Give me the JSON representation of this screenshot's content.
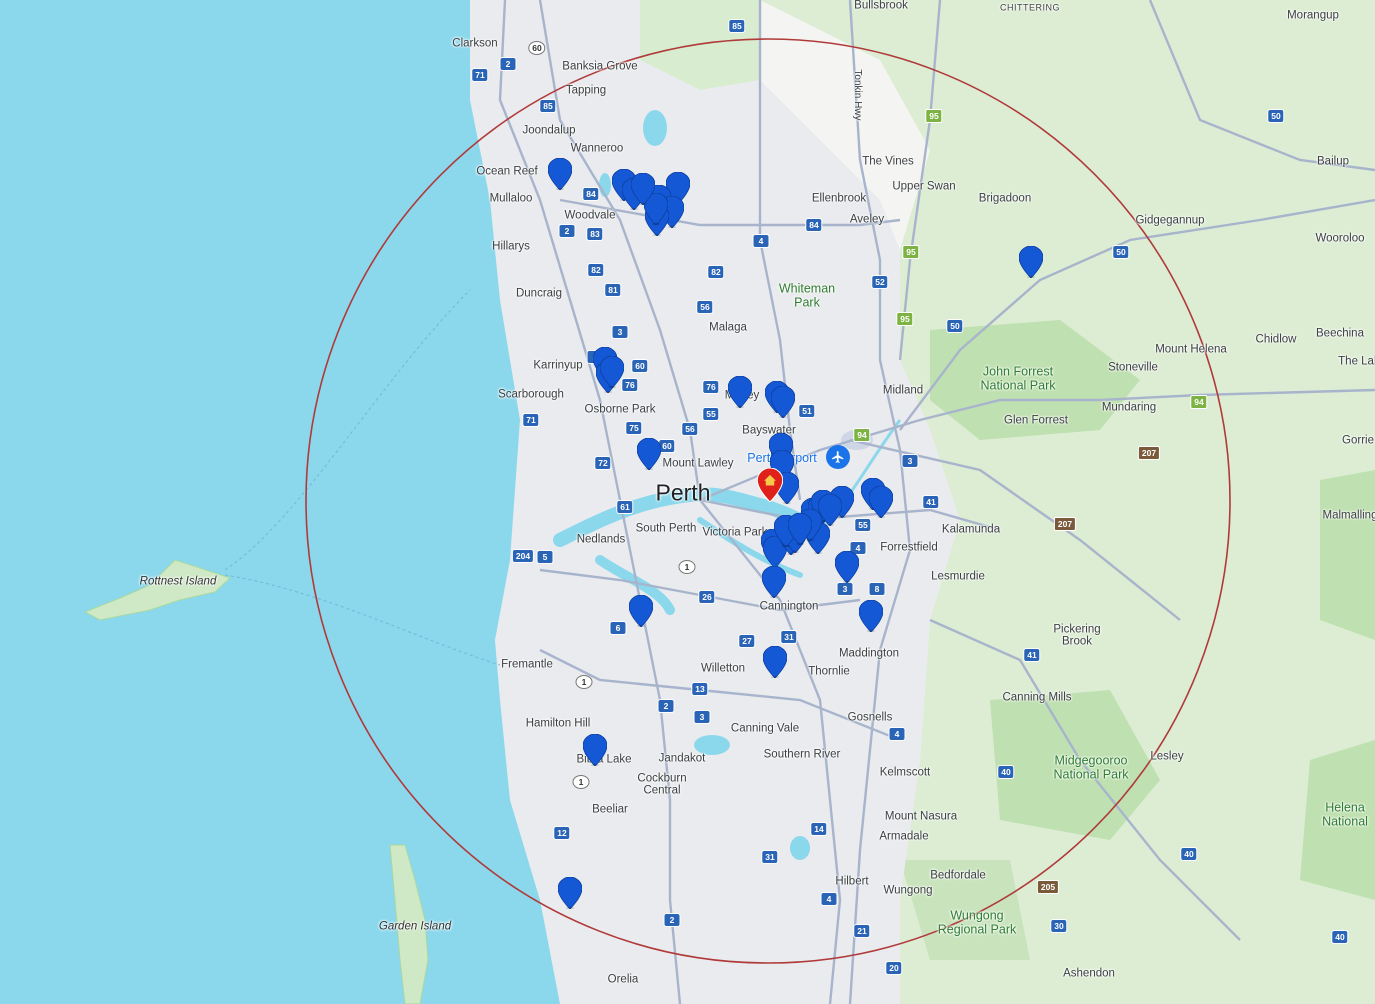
{
  "map": {
    "colors": {
      "water": "#8bd8ec",
      "land": "#f4f4f2",
      "green": "#cfe8c6",
      "urban": "#e8eaed",
      "circle": "#b03a3a",
      "pin_blue": "#1558d6",
      "pin_red": "#e0201a",
      "pin_home": "#f7c948"
    },
    "city_label": "Perth",
    "airport_label": "Perth Airport",
    "islands": [
      {
        "id": "rottnest",
        "name": "Rottnest Island"
      },
      {
        "id": "garden",
        "name": "Garden Island"
      }
    ],
    "places": [
      {
        "name": "Bullsbrook"
      },
      {
        "name": "CHITTERING"
      },
      {
        "name": "Morangup"
      },
      {
        "name": "Clarkson"
      },
      {
        "name": "Banksia Grove"
      },
      {
        "name": "Tapping"
      },
      {
        "name": "Joondalup"
      },
      {
        "name": "Wanneroo"
      },
      {
        "name": "Ocean Reef"
      },
      {
        "name": "Mullaloo"
      },
      {
        "name": "Woodvale"
      },
      {
        "name": "Hillarys"
      },
      {
        "name": "Duncraig"
      },
      {
        "name": "Malaga"
      },
      {
        "name": "The Vines"
      },
      {
        "name": "Upper Swan"
      },
      {
        "name": "Ellenbrook"
      },
      {
        "name": "Aveley"
      },
      {
        "name": "Brigadoon"
      },
      {
        "name": "Bailup"
      },
      {
        "name": "Gidgegannup"
      },
      {
        "name": "Wooroloo"
      },
      {
        "name": "Karrinyup"
      },
      {
        "name": "Scarborough"
      },
      {
        "name": "Osborne Park"
      },
      {
        "name": "Morley"
      },
      {
        "name": "Bayswater"
      },
      {
        "name": "Midland"
      },
      {
        "name": "Beechina"
      },
      {
        "name": "Chidlow"
      },
      {
        "name": "Mount Helena"
      },
      {
        "name": "Stoneville"
      },
      {
        "name": "The Lakes"
      },
      {
        "name": "Mundaring"
      },
      {
        "name": "Glen Forrest"
      },
      {
        "name": "Gorrie"
      },
      {
        "name": "Mount Lawley"
      },
      {
        "name": "South Perth"
      },
      {
        "name": "Victoria Park"
      },
      {
        "name": "Nedlands"
      },
      {
        "name": "Forrestfield"
      },
      {
        "name": "Kalamunda"
      },
      {
        "name": "Malmalling"
      },
      {
        "name": "Lesmurdie"
      },
      {
        "name": "Cannington"
      },
      {
        "name": "Pickering Brook"
      },
      {
        "name": "Fremantle"
      },
      {
        "name": "Willetton"
      },
      {
        "name": "Thornlie"
      },
      {
        "name": "Maddington"
      },
      {
        "name": "Canning Mills"
      },
      {
        "name": "Hamilton Hill"
      },
      {
        "name": "Canning Vale"
      },
      {
        "name": "Gosnells"
      },
      {
        "name": "Bibra Lake"
      },
      {
        "name": "Jandakot"
      },
      {
        "name": "Southern River"
      },
      {
        "name": "Lesley"
      },
      {
        "name": "Cockburn Central"
      },
      {
        "name": "Kelmscott"
      },
      {
        "name": "Beeliar"
      },
      {
        "name": "Mount Nasura"
      },
      {
        "name": "Armadale"
      },
      {
        "name": "Bedfordale"
      },
      {
        "name": "Hilbert"
      },
      {
        "name": "Wungong"
      },
      {
        "name": "Orelia"
      },
      {
        "name": "Ashendon"
      },
      {
        "name": "Tonkin Hwy"
      }
    ],
    "parks": [
      {
        "name": "Whiteman Park"
      },
      {
        "name": "John Forrest National Park"
      },
      {
        "name": "Midgegooroo National Park"
      },
      {
        "name": "Wungong Regional Park"
      },
      {
        "name": "Helena National"
      }
    ],
    "route_numbers": [
      "85",
      "60",
      "71",
      "2",
      "85",
      "84",
      "2",
      "83",
      "82",
      "81",
      "82",
      "3",
      "60",
      "76",
      "2",
      "76",
      "75",
      "55",
      "56",
      "72",
      "71",
      "60",
      "61",
      "5",
      "204",
      "1",
      "26",
      "6",
      "1",
      "27",
      "31",
      "13",
      "2",
      "3",
      "1",
      "12",
      "14",
      "31",
      "4",
      "21",
      "2",
      "20",
      "4",
      "8",
      "3",
      "55",
      "41",
      "4",
      "3",
      "94",
      "50",
      "52",
      "51",
      "4",
      "84",
      "56",
      "95",
      "95",
      "95",
      "50",
      "50",
      "94",
      "207",
      "207",
      "41",
      "40",
      "40",
      "205",
      "30",
      "40"
    ],
    "markers": {
      "blue_count": 42,
      "home": {
        "type": "home",
        "color": "red"
      }
    }
  }
}
